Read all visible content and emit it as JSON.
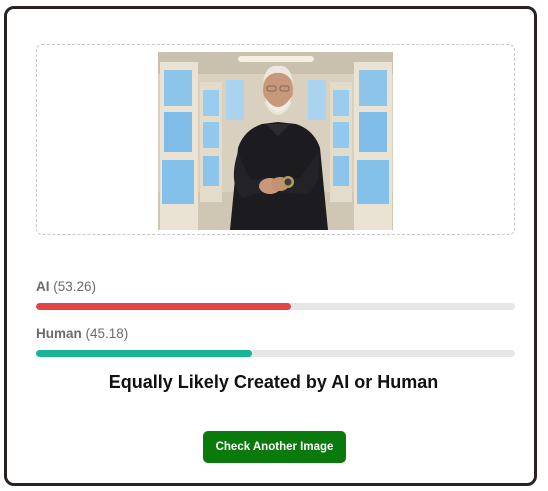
{
  "image_alt": "Uploaded image preview",
  "results": [
    {
      "label": "AI",
      "value_text": "(53.26)",
      "percent": 53.26,
      "color": "#e04646"
    },
    {
      "label": "Human",
      "value_text": "(45.18)",
      "percent": 45.18,
      "color": "#1ab394"
    }
  ],
  "verdict": "Equally Likely Created by AI or Human",
  "button_label": "Check Another Image",
  "colors": {
    "card_border": "#2a2220",
    "button": "#0a7a0c",
    "track": "#e6e6e6"
  }
}
